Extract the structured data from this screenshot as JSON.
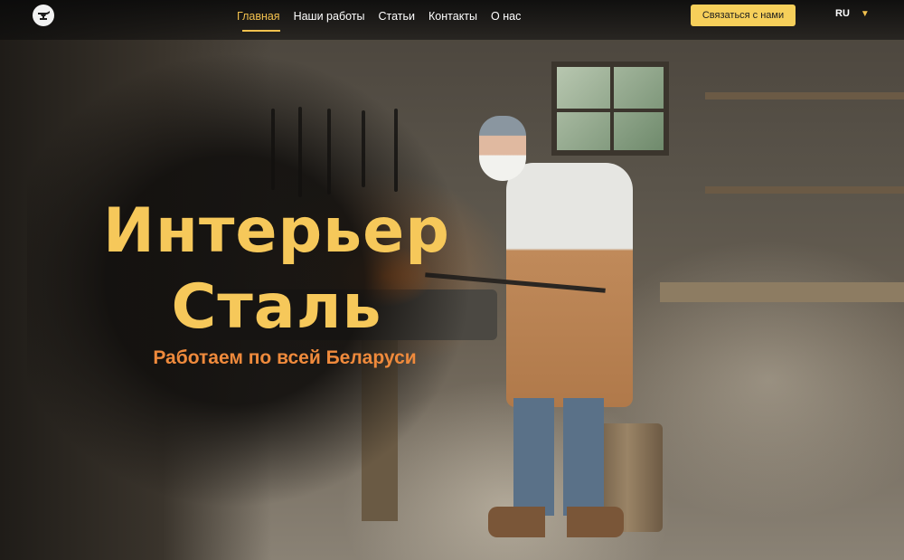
{
  "header": {
    "logo": {
      "icon": "anvil-icon"
    },
    "nav": [
      {
        "label": "Главная",
        "active": true
      },
      {
        "label": "Наши работы",
        "active": false
      },
      {
        "label": "Статьи",
        "active": false
      },
      {
        "label": "Контакты",
        "active": false
      },
      {
        "label": "О нас",
        "active": false
      }
    ],
    "cta_label": "Связаться с нами",
    "language": "RU",
    "language_caret": "▼"
  },
  "hero": {
    "title_line1": "Интерьер",
    "title_line2": "Сталь",
    "subtitle": "Работаем по всей Беларуси",
    "background_image": "blacksmith-workshop-illustration"
  },
  "colors": {
    "accent": "#f6c85a",
    "subtitle": "#ef8a3c",
    "cta_bg": "#f6cf5a",
    "nav_active": "#f2c14e"
  }
}
